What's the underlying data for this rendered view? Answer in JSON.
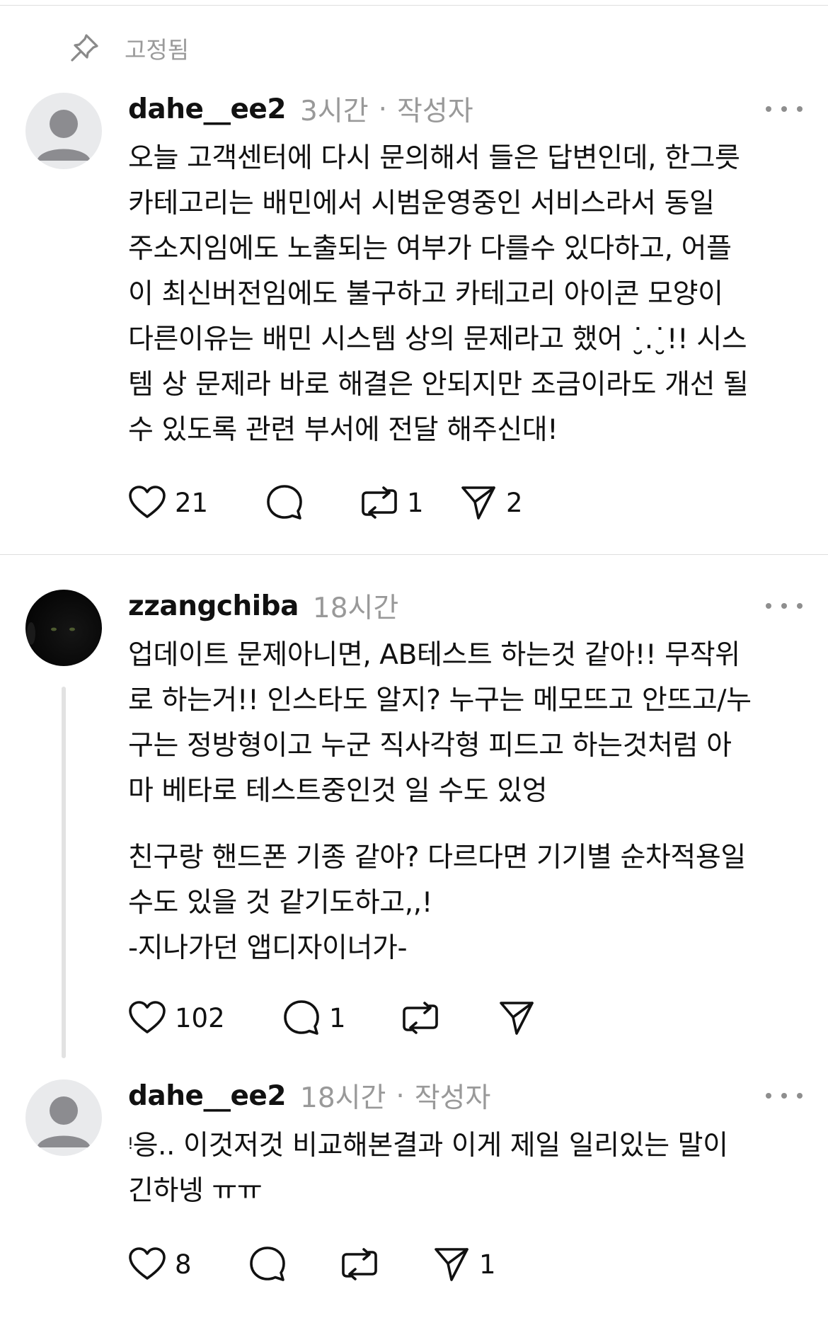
{
  "pinned": {
    "label": "고정됨",
    "icon": "pin-icon"
  },
  "posts": [
    {
      "username": "dahe__ee2",
      "time": "3시간",
      "separator": "·",
      "badge": "작성자",
      "avatar": "default-profile",
      "body": [
        "오늘 고객센터에 다시 문의해서 들은 답변인데, 한그릇",
        "카테고리는 배민에서 시범운영중인 서비스라서 동일",
        "주소지임에도 노출되는 여부가 다를수 있다하고, 어플",
        "이 최신버전임에도 불구하고 카테고리 아이콘 모양이",
        "다른이유는 배민 시스템 상의 문제라고 했어 ˙̮.˙̮!! 시스",
        "템 상 문제라 바로 해결은 안되지만 조금이라도 개선 될",
        "수 있도록 관련 부서에 전달 해주신대!"
      ],
      "likes": "21",
      "replies": "",
      "reposts": "1",
      "shares": "2"
    },
    {
      "username": "zzangchiba",
      "time": "18시간",
      "avatar": "black-cat",
      "body": [
        "업데이트 문제아니면, AB테스트 하는것 같아!! 무작위",
        "로 하는거!! 인스타도 알지? 누구는 메모뜨고 안뜨고/누",
        "구는 정방형이고 누군 직사각형 피드고 하는것처럼 아",
        "마 베타로 테스트중인것 일 수도 있엉"
      ],
      "body2": [
        "친구랑 핸드폰 기종 같아? 다르다면 기기별 순차적용일",
        "수도 있을 것 같기도하고,,!",
        "-지나가던 앱디자이너가-"
      ],
      "likes": "102",
      "replies": "1",
      "reposts": "",
      "shares": ""
    },
    {
      "username": "dahe__ee2",
      "time": "18시간",
      "separator": "·",
      "badge": "작성자",
      "avatar": "default-profile",
      "body": [
        "ᵎ응.. 이것저것 비교해본결과 이게 제일 일리있는 말이",
        "긴하넹 ㅠㅠ"
      ],
      "likes": "8",
      "replies": "",
      "reposts": "",
      "shares": "1"
    }
  ],
  "colors": {
    "text": "#111111",
    "muted": "#999999",
    "divider": "#dedede",
    "thread": "#e2e2e2"
  }
}
